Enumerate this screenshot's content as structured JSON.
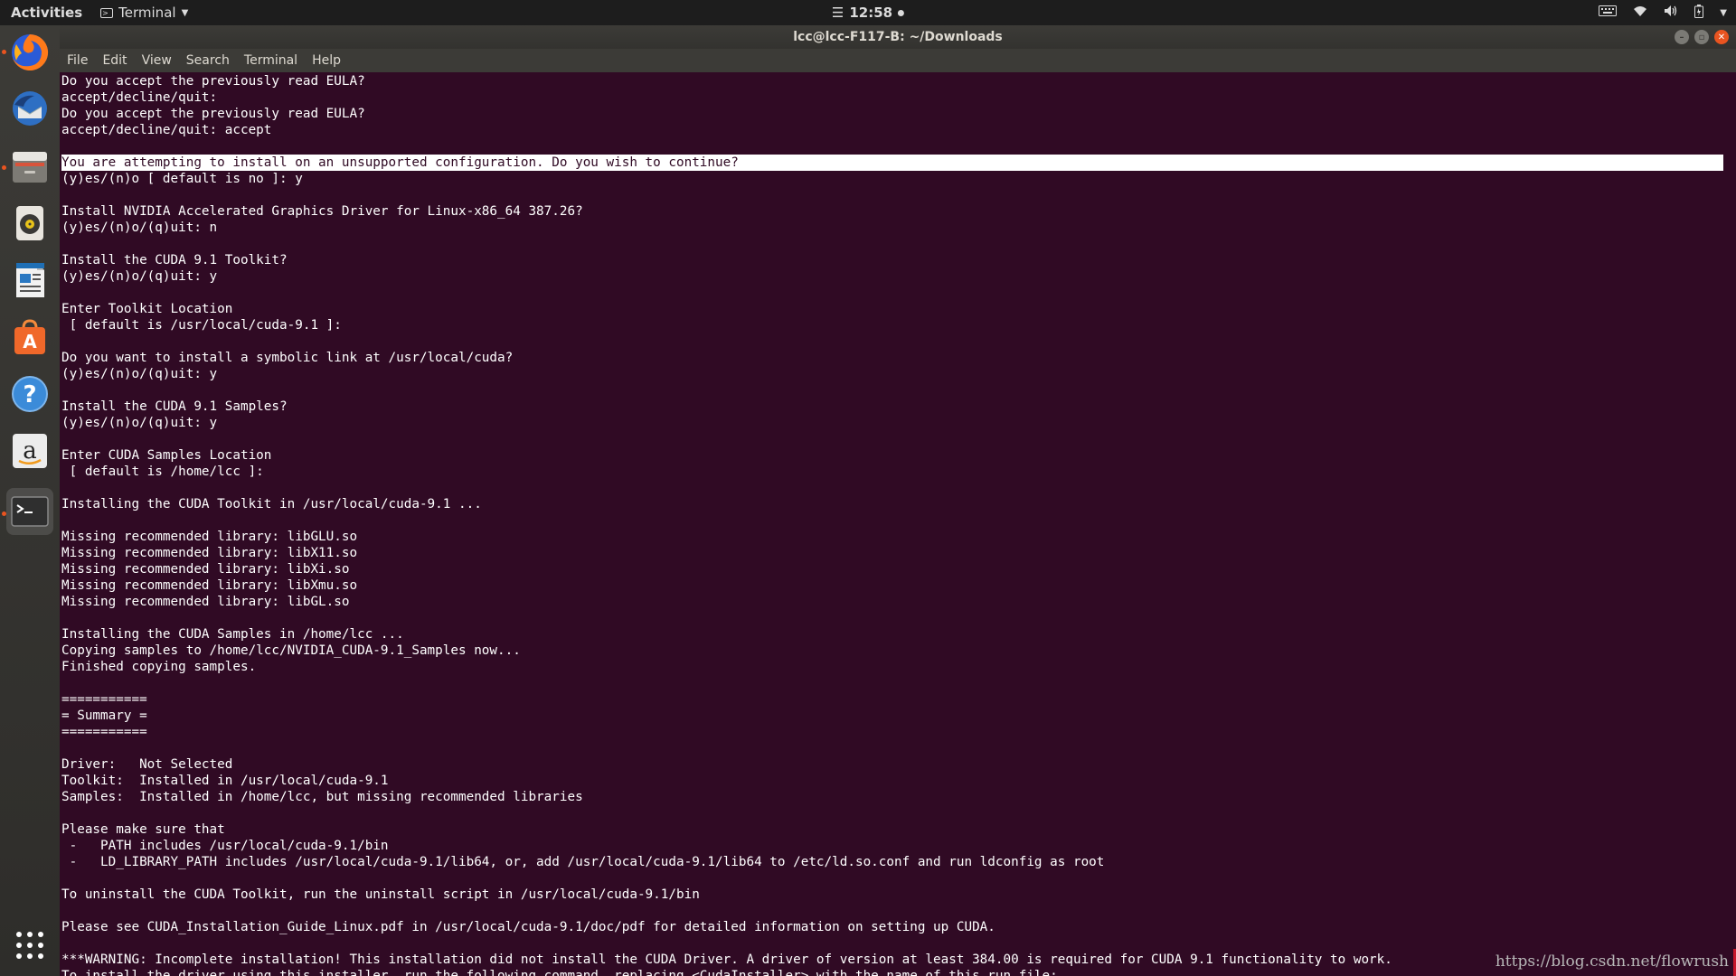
{
  "topbar": {
    "activities": "Activities",
    "app_menu": "Terminal",
    "clock": "12:58"
  },
  "dock": {
    "items": [
      {
        "name": "firefox",
        "icon": "firefox-icon"
      },
      {
        "name": "thunderbird",
        "icon": "mail-icon"
      },
      {
        "name": "files",
        "icon": "files-icon"
      },
      {
        "name": "rhythmbox",
        "icon": "music-icon"
      },
      {
        "name": "writer",
        "icon": "document-icon"
      },
      {
        "name": "software",
        "icon": "software-center-icon"
      },
      {
        "name": "help",
        "icon": "help-icon"
      },
      {
        "name": "amazon",
        "icon": "amazon-icon"
      },
      {
        "name": "terminal",
        "icon": "terminal-icon"
      },
      {
        "name": "show-applications",
        "icon": "grid-icon"
      }
    ]
  },
  "window": {
    "title": "lcc@lcc-F117-B: ~/Downloads",
    "menu": [
      "File",
      "Edit",
      "View",
      "Search",
      "Terminal",
      "Help"
    ]
  },
  "terminal": {
    "highlight_line": 5,
    "lines": [
      "Do you accept the previously read EULA?",
      "accept/decline/quit:",
      "Do you accept the previously read EULA?",
      "accept/decline/quit: accept",
      "",
      "You are attempting to install on an unsupported configuration. Do you wish to continue?",
      "(y)es/(n)o [ default is no ]: y",
      "",
      "Install NVIDIA Accelerated Graphics Driver for Linux-x86_64 387.26?",
      "(y)es/(n)o/(q)uit: n",
      "",
      "Install the CUDA 9.1 Toolkit?",
      "(y)es/(n)o/(q)uit: y",
      "",
      "Enter Toolkit Location",
      " [ default is /usr/local/cuda-9.1 ]:",
      "",
      "Do you want to install a symbolic link at /usr/local/cuda?",
      "(y)es/(n)o/(q)uit: y",
      "",
      "Install the CUDA 9.1 Samples?",
      "(y)es/(n)o/(q)uit: y",
      "",
      "Enter CUDA Samples Location",
      " [ default is /home/lcc ]:",
      "",
      "Installing the CUDA Toolkit in /usr/local/cuda-9.1 ...",
      "",
      "Missing recommended library: libGLU.so",
      "Missing recommended library: libX11.so",
      "Missing recommended library: libXi.so",
      "Missing recommended library: libXmu.so",
      "Missing recommended library: libGL.so",
      "",
      "Installing the CUDA Samples in /home/lcc ...",
      "Copying samples to /home/lcc/NVIDIA_CUDA-9.1_Samples now...",
      "Finished copying samples.",
      "",
      "===========",
      "= Summary =",
      "===========",
      "",
      "Driver:   Not Selected",
      "Toolkit:  Installed in /usr/local/cuda-9.1",
      "Samples:  Installed in /home/lcc, but missing recommended libraries",
      "",
      "Please make sure that",
      " -   PATH includes /usr/local/cuda-9.1/bin",
      " -   LD_LIBRARY_PATH includes /usr/local/cuda-9.1/lib64, or, add /usr/local/cuda-9.1/lib64 to /etc/ld.so.conf and run ldconfig as root",
      "",
      "To uninstall the CUDA Toolkit, run the uninstall script in /usr/local/cuda-9.1/bin",
      "",
      "Please see CUDA_Installation_Guide_Linux.pdf in /usr/local/cuda-9.1/doc/pdf for detailed information on setting up CUDA.",
      "",
      "***WARNING: Incomplete installation! This installation did not install the CUDA Driver. A driver of version at least 384.00 is required for CUDA 9.1 functionality to work.",
      "To install the driver using this installer, run the following command, replacing <CudaInstaller> with the name of this run file:"
    ]
  },
  "watermark": "https://blog.csdn.net/flowrush"
}
